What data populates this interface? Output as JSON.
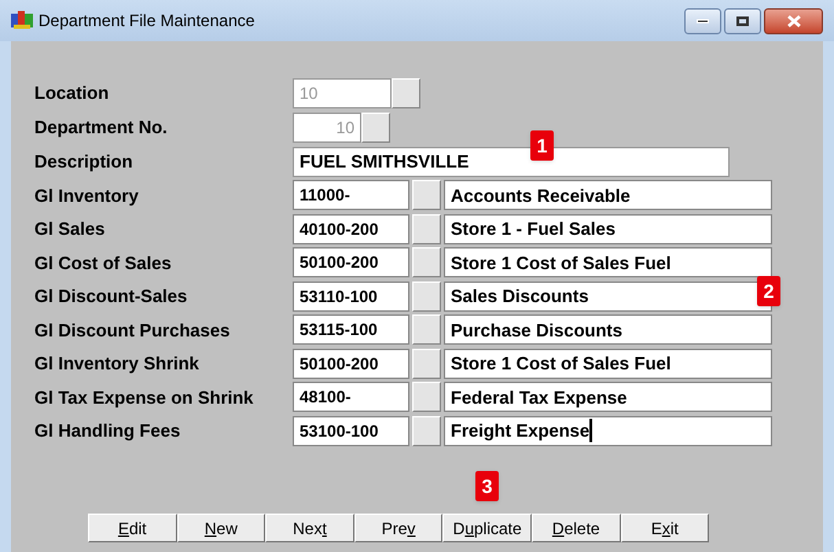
{
  "window": {
    "title": "Department File Maintenance"
  },
  "location": {
    "label": "Location",
    "value": "10",
    "disabled": true
  },
  "department": {
    "label": "Department No.",
    "value": "10",
    "disabled": true
  },
  "description": {
    "label": "Description",
    "value": "FUEL SMITHSVILLE"
  },
  "accounts": [
    {
      "label": "Gl Inventory",
      "code": "11000-",
      "name": "Accounts Receivable",
      "focused": false
    },
    {
      "label": "Gl Sales",
      "code": "40100-200",
      "name": "Store 1 - Fuel Sales",
      "focused": false
    },
    {
      "label": "Gl Cost of Sales",
      "code": "50100-200",
      "name": "Store 1 Cost of Sales Fuel",
      "focused": false
    },
    {
      "label": "Gl Discount-Sales",
      "code": "53110-100",
      "name": "Sales Discounts",
      "focused": false
    },
    {
      "label": "Gl Discount Purchases",
      "code": "53115-100",
      "name": "Purchase Discounts",
      "focused": false
    },
    {
      "label": "Gl Inventory Shrink",
      "code": "50100-200",
      "name": "Store 1 Cost of Sales Fuel",
      "focused": false
    },
    {
      "label": "Gl Tax Expense on Shrink",
      "code": "48100-",
      "name": "Federal Tax Expense",
      "focused": false
    },
    {
      "label": "Gl Handling Fees",
      "code": "53100-100",
      "name": "Freight Expense",
      "focused": true
    }
  ],
  "buttons": [
    {
      "access_key": "E",
      "label_end": "dit"
    },
    {
      "access_key": "N",
      "label_end": "ew"
    },
    {
      "label_start": "Nex",
      "access_key": "t"
    },
    {
      "label_start": "Pre",
      "access_key": "v"
    },
    {
      "label_start": "D",
      "access_key": "u",
      "label_end": "plicate"
    },
    {
      "access_key": "D",
      "label_end": "elete"
    },
    {
      "label_start": "E",
      "access_key": "x",
      "label_end": "it"
    }
  ],
  "callouts": [
    "1",
    "2",
    "3"
  ]
}
